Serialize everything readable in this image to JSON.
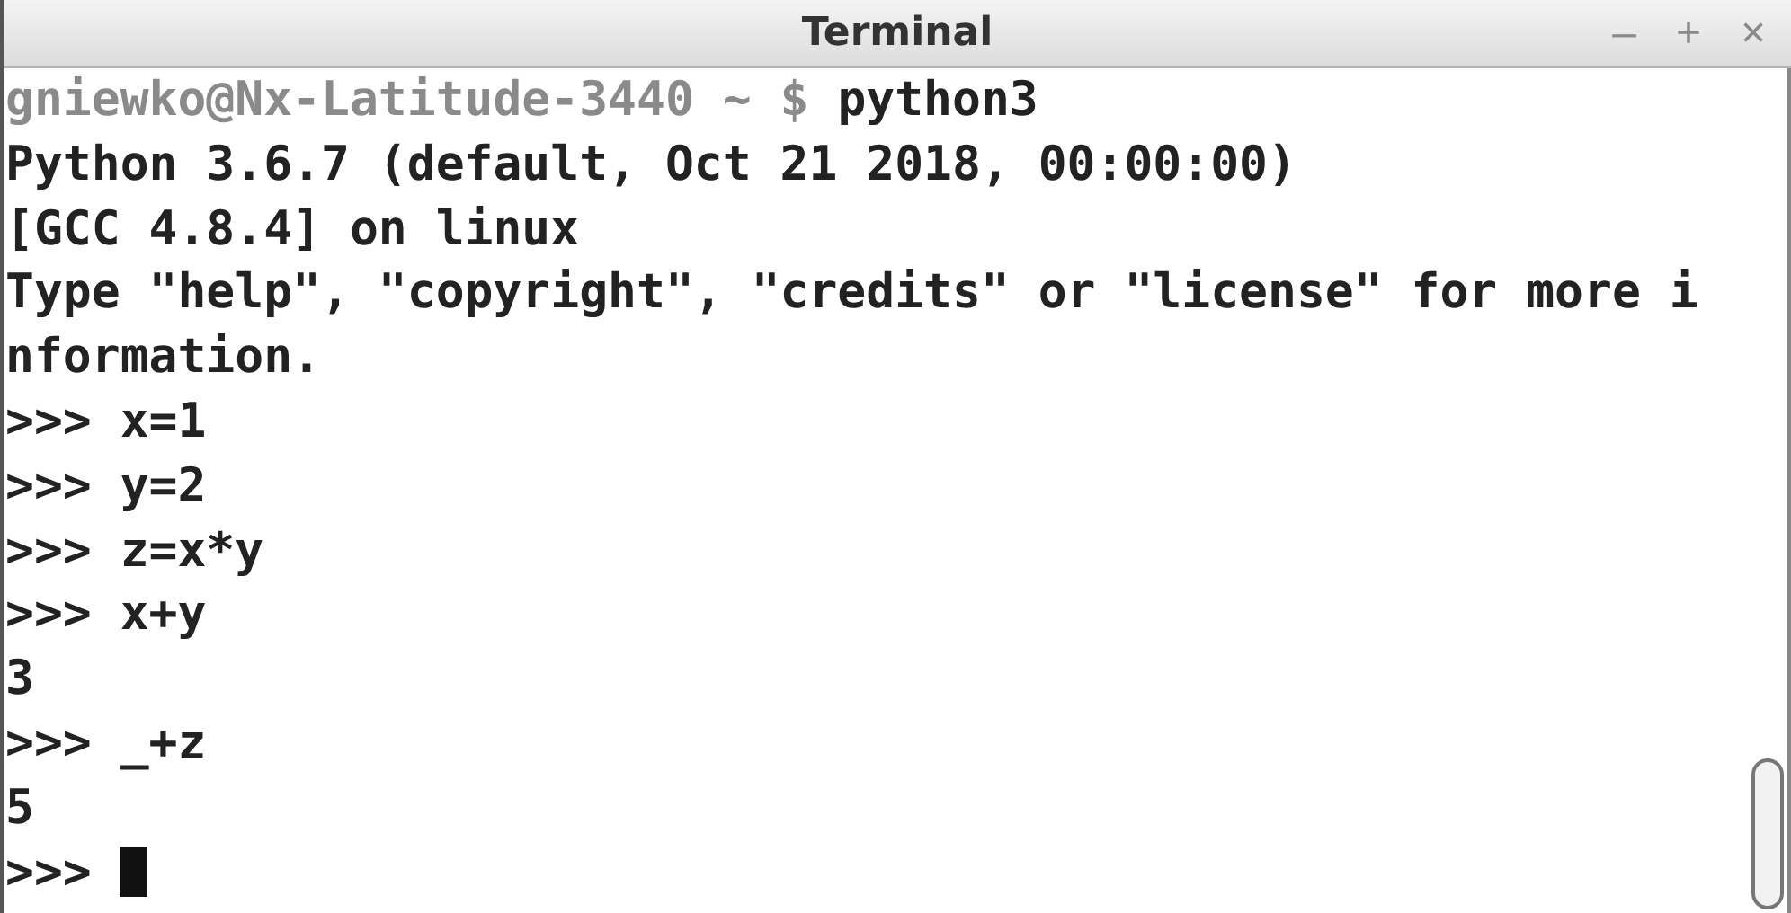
{
  "window": {
    "title": "Terminal",
    "controls": [
      "–",
      "+",
      "×"
    ]
  },
  "lines": [
    {
      "kind": "shell",
      "prompt": "gniewko@Nx-Latitude-3440 ~ $",
      "text": " python3"
    },
    {
      "kind": "text",
      "text": "Python 3.6.7 (default, Oct 21 2018, 00:00:00)"
    },
    {
      "kind": "text",
      "text": "[GCC 4.8.4] on linux"
    },
    {
      "kind": "text",
      "text": "Type \"help\", \"copyright\", \"credits\" or \"license\" for more i"
    },
    {
      "kind": "text",
      "text": "nformation."
    },
    {
      "kind": "text",
      "text": ">>> x=1"
    },
    {
      "kind": "text",
      "text": ">>> y=2"
    },
    {
      "kind": "text",
      "text": ">>> z=x*y"
    },
    {
      "kind": "text",
      "text": ">>> x+y"
    },
    {
      "kind": "text",
      "text": "3"
    },
    {
      "kind": "text",
      "text": ">>> _+z"
    },
    {
      "kind": "text",
      "text": "5"
    },
    {
      "kind": "input",
      "text": ">>> "
    }
  ]
}
